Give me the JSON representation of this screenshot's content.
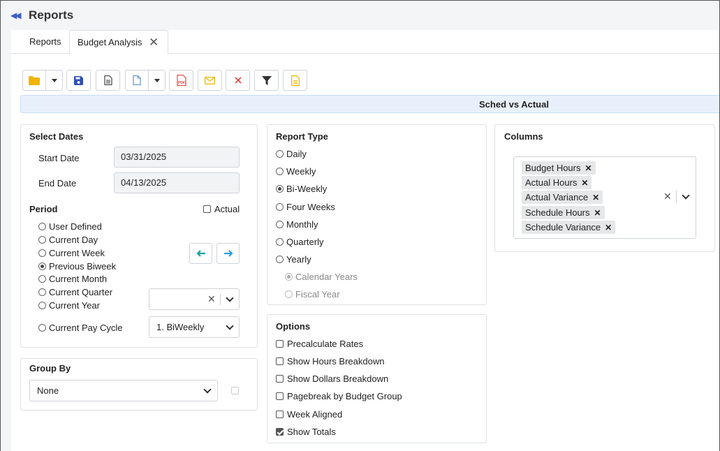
{
  "app": {
    "title": "Reports"
  },
  "tabs": [
    {
      "label": "Reports"
    },
    {
      "label": "Budget Analysis"
    }
  ],
  "icons": {
    "back": "double-chevron-left-icon",
    "folder": "folder-icon",
    "save": "save-icon",
    "document": "document-icon",
    "new": "new-file-icon",
    "pdf": "pdf-icon",
    "email": "email-icon",
    "delete": "delete-icon",
    "filter": "filter-icon",
    "notes": "notes-icon",
    "close_tab": "close-icon"
  },
  "colors": {
    "accent": "#3a5fc8",
    "folder": "#f0b400",
    "pdf": "#e0463e",
    "email": "#f0b400",
    "delete": "#e0463e",
    "arrow_left": "#1aa39a",
    "arrow_right": "#2d9ee0",
    "banner": "#e8f1fb"
  },
  "pdf_text": "PDF",
  "banner": {
    "title": "Sched vs Actual"
  },
  "select_dates": {
    "title": "Select Dates",
    "start_label": "Start Date",
    "start_value": "03/31/2025",
    "end_label": "End Date",
    "end_value": "04/13/2025",
    "period_label": "Period",
    "actual_label": "Actual",
    "actual_checked": false,
    "periods": [
      {
        "label": "User Defined",
        "selected": false
      },
      {
        "label": "Current Day",
        "selected": false
      },
      {
        "label": "Current Week",
        "selected": false
      },
      {
        "label": "Previous Biweek",
        "selected": true
      },
      {
        "label": "Current Month",
        "selected": false
      },
      {
        "label": "Current Quarter",
        "selected": false
      },
      {
        "label": "Current Year",
        "selected": false
      },
      {
        "label": "Current Pay Cycle",
        "selected": false
      }
    ],
    "pay_cycle_value": "1. BiWeekly",
    "clear_glyph": "✕"
  },
  "group_by": {
    "title": "Group By",
    "value": "None",
    "checked": false
  },
  "report_type": {
    "title": "Report Type",
    "options": [
      {
        "label": "Daily",
        "selected": false
      },
      {
        "label": "Weekly",
        "selected": false
      },
      {
        "label": "Bi-Weekly",
        "selected": true
      },
      {
        "label": "Four Weeks",
        "selected": false
      },
      {
        "label": "Monthly",
        "selected": false
      },
      {
        "label": "Quarterly",
        "selected": false
      },
      {
        "label": "Yearly",
        "selected": false
      }
    ],
    "sub_options": [
      {
        "label": "Calendar Years",
        "selected": true
      },
      {
        "label": "Fiscal Year",
        "selected": false
      }
    ]
  },
  "options": {
    "title": "Options",
    "items": [
      {
        "label": "Precalculate Rates",
        "checked": false
      },
      {
        "label": "Show Hours Breakdown",
        "checked": false
      },
      {
        "label": "Show Dollars Breakdown",
        "checked": false
      },
      {
        "label": "Pagebreak by Budget Group",
        "checked": false
      },
      {
        "label": "Week Aligned",
        "checked": false
      },
      {
        "label": "Show Totals",
        "checked": true
      }
    ]
  },
  "columns": {
    "title": "Columns",
    "tags": [
      "Budget Hours",
      "Actual Hours",
      "Actual Variance",
      "Schedule Hours",
      "Schedule Variance"
    ],
    "remove_glyph": "✕"
  }
}
